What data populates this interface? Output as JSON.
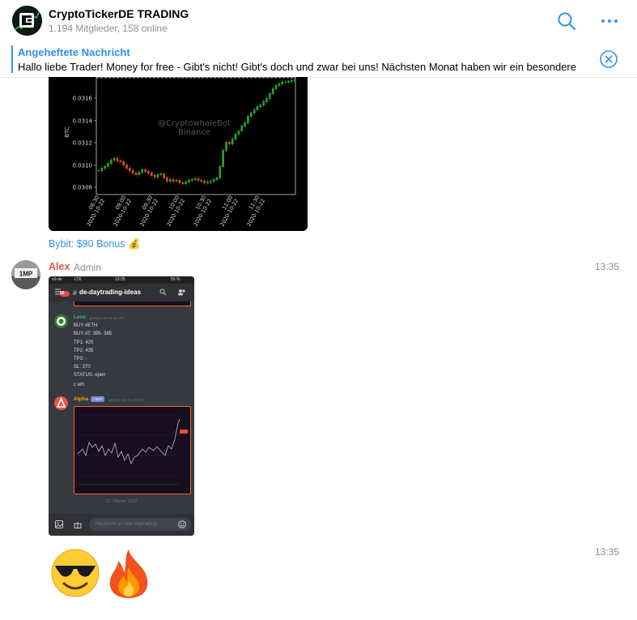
{
  "header": {
    "title": "CryptoTickerDE TRADING",
    "subtitle": "1.194 Mitglieder, 158 online"
  },
  "pinned": {
    "title": "Angeheftete Nachricht",
    "text": "Hallo liebe Trader!  Money for free - Gibt's nicht! Gibt's doch und zwar bei uns!  Nächsten Monat haben wir ein besondere"
  },
  "chart_preview": {
    "watermark_line1": "@CryptowhaleBot",
    "watermark_line2": "Binance",
    "ylabel": "BTC",
    "y_ticks": [
      "0.0316",
      "0.0314",
      "0.0312",
      "0.0310",
      "0.0308"
    ],
    "x_ticks": [
      {
        "time": "08:30",
        "date": "2020-10-22"
      },
      {
        "time": "09:00",
        "date": "2020-10-22"
      },
      {
        "time": "09:30",
        "date": "2020-10-22"
      },
      {
        "time": "10:00",
        "date": "2020-10-22"
      },
      {
        "time": "10:30",
        "date": "2020-10-22"
      },
      {
        "time": "11:00",
        "date": "2020-10-22"
      },
      {
        "time": "11:30",
        "date": "2020-10-22"
      }
    ],
    "up_color": "#2ca02c",
    "down_color": "#d9472b"
  },
  "bonus_link": "Bybit: $90 Bonus 💰",
  "message": {
    "sender": "Alex",
    "role": "Admin",
    "time": "13:35",
    "avatar_text": "1MP"
  },
  "phone": {
    "carrier": "o2-de",
    "network": "LTE",
    "clock": "13:35",
    "battery": "50 %",
    "badge": "56",
    "channel": "de-daytrading-ideas",
    "msg1": {
      "author": "Lexx",
      "meta": "gestern um 21:40 Uhr",
      "lines": [
        "BUY #ETH",
        "BUY AT: 395- 385",
        "TP1: 420",
        "TP2: 435",
        "TP3: -",
        "SL: 370",
        "STATUS: open",
        "c eth"
      ]
    },
    "msg2": {
      "author": "Alpha",
      "bot_tag": "✓BOT",
      "meta": "gestern um 21:40 Uhr"
    },
    "date_divider": "22. Oktober 2020",
    "input_placeholder": "Nachricht an #de-daytrading-..."
  },
  "message2": {
    "time": "13:35",
    "emojis": [
      "😎",
      "🔥"
    ]
  }
}
